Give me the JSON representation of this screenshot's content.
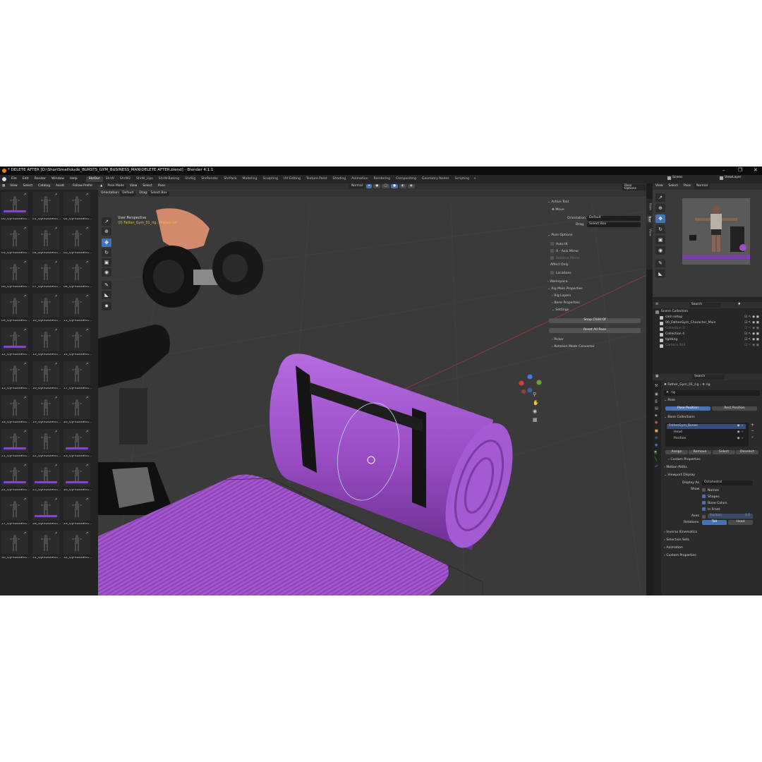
{
  "window": {
    "title": "* DELETE AFTER [D:\\ShortSmall\\dude_BURSTS_GYM_BUSINESS_MAN\\DELETE AFTER.blend] - Blender 4.1.1"
  },
  "menu": [
    "File",
    "Edit",
    "Render",
    "Window",
    "Help"
  ],
  "workspaces": [
    "ShrDur",
    "ShrW",
    "ShrW2",
    "ShrW_Lips",
    "ShrW-Baking",
    "ShrRig",
    "ShrRender",
    "ShrPack",
    "Modeling",
    "Sculpting",
    "UV Editing",
    "Texture Paint",
    "Shading",
    "Animation",
    "Rendering",
    "Compositing",
    "Geometry Nodes",
    "Scripting"
  ],
  "active_workspace": "ShrDur",
  "scene": {
    "label": "Scene",
    "view_layer": "ViewLayer"
  },
  "asset_header": {
    "items": [
      "View",
      "Select",
      "Catalog",
      "Asset"
    ],
    "follow": "Follow Prefer"
  },
  "assets": [
    "00_GymDude01...",
    "01_GymDude01...",
    "02_GymDude01...",
    "03_GymDude01...",
    "04_GymDude01...",
    "05_GymDude01...",
    "06_GymDude01...",
    "07_GymDude01...",
    "08_GymDude01...",
    "09_GymDude01...",
    "10_GymDude01...",
    "11_GymDude01...",
    "12_GymDude01...",
    "13_GymDude01...",
    "14_GymDude01...",
    "15_GymDude01...",
    "16_GymDude01...",
    "17_GymDude01...",
    "18_GymDude01...",
    "19_GymDude01...",
    "20_GymDude01...",
    "21_GymDude01...",
    "22_GymDude01...",
    "23_GymDude01...",
    "24_GymDude01...",
    "25_GymDude01...",
    "26_GymDude01...",
    "27_GymDude01...",
    "28_GymDude01...",
    "29_GymDude01...",
    "30_GymDude01...",
    "31_GymDude01...",
    "32_GymDude01..."
  ],
  "viewport_header": {
    "mode": "Pose Mode",
    "menus": [
      "View",
      "Select",
      "Pose"
    ],
    "orientation_label": "Orientation:",
    "orientation_value": "Default",
    "drag_label": "Drag:",
    "drag_value": "Select Box",
    "shading": "Normal",
    "pose_options": "Pose Options"
  },
  "overlay_text": {
    "perspective": "User Perspective",
    "object": "(0) Father_Gym_01_rig : Mattes-rot"
  },
  "npanel": {
    "tabs": [
      "Item",
      "Tool",
      "View"
    ],
    "active_tool": "Active Tool",
    "move": "Move",
    "orientation_label": "Orientation",
    "orientation_value": "Default",
    "drag_label": "Drag",
    "drag_value": "Select Box",
    "pose_options": "Pose Options",
    "auto_ik": "Auto IK",
    "x_axis_mirror": "X - Axis Mirror",
    "relative_mirror": "Relative Mirror",
    "affect_only": "Affect Only",
    "locations": "Locations",
    "workspace": "Workspace",
    "rig_main": "Rig Main Properties",
    "rig_layers": "Rig Layers",
    "bone_properties": "Bone Properties",
    "settings": "Settings",
    "snap_child": "Snap Child Of",
    "reset_all": "Reset All Pose",
    "picker": "Picker",
    "rotation_convertor": "Rotation Mode Convertor"
  },
  "right_header": {
    "menus": [
      "View",
      "Select",
      "Pose"
    ],
    "shading": "Normal"
  },
  "outliner": {
    "search_placeholder": "Search",
    "items": [
      {
        "name": "Scene Collection",
        "indent": 0,
        "dim": false
      },
      {
        "name": "cam setup",
        "indent": 1,
        "dim": false
      },
      {
        "name": "00_FatherGym_Character_Main",
        "indent": 1,
        "dim": false
      },
      {
        "name": "Collection 3",
        "indent": 1,
        "dim": true
      },
      {
        "name": "Collection 4",
        "indent": 1,
        "dim": false
      },
      {
        "name": "lighting",
        "indent": 1,
        "dim": false
      },
      {
        "name": "Camera.003",
        "indent": 1,
        "dim": true
      }
    ]
  },
  "properties": {
    "search_placeholder": "Search",
    "object_name": "Father_Gym_01_rig",
    "data_name": "rig",
    "data_field": "rig",
    "pose_header": "Pose",
    "pose_position": "Pose Position",
    "rest_position": "Rest Position",
    "bone_collections": "Bone Collections",
    "collections": [
      "FatherGym_Bones",
      "Head",
      "Position"
    ],
    "assign": "Assign",
    "remove": "Remove",
    "select": "Select",
    "deselect": "Deselect",
    "custom_props": "Custom Properties",
    "motion_paths": "Motion Paths",
    "viewport_display": "Viewport Display",
    "display_as_label": "Display As",
    "display_as_value": "Octahedral",
    "show_label": "Show",
    "names": "Names",
    "shapes": "Shapes",
    "bone_colors": "Bone Colors",
    "in_front": "In Front",
    "axes_label": "Axes",
    "position_label": "Position",
    "position_value": "0.0",
    "relations_label": "Relations",
    "tail": "Tail",
    "head": "Head",
    "inverse_kinematics": "Inverse Kinematics",
    "selection_sets": "Selection Sets",
    "animation": "Animation",
    "custom_properties": "Custom Properties"
  },
  "colors": {
    "accent_blue": "#4772b3",
    "mat_purple": "#9a4fc4",
    "background": "#1d1d1d"
  }
}
